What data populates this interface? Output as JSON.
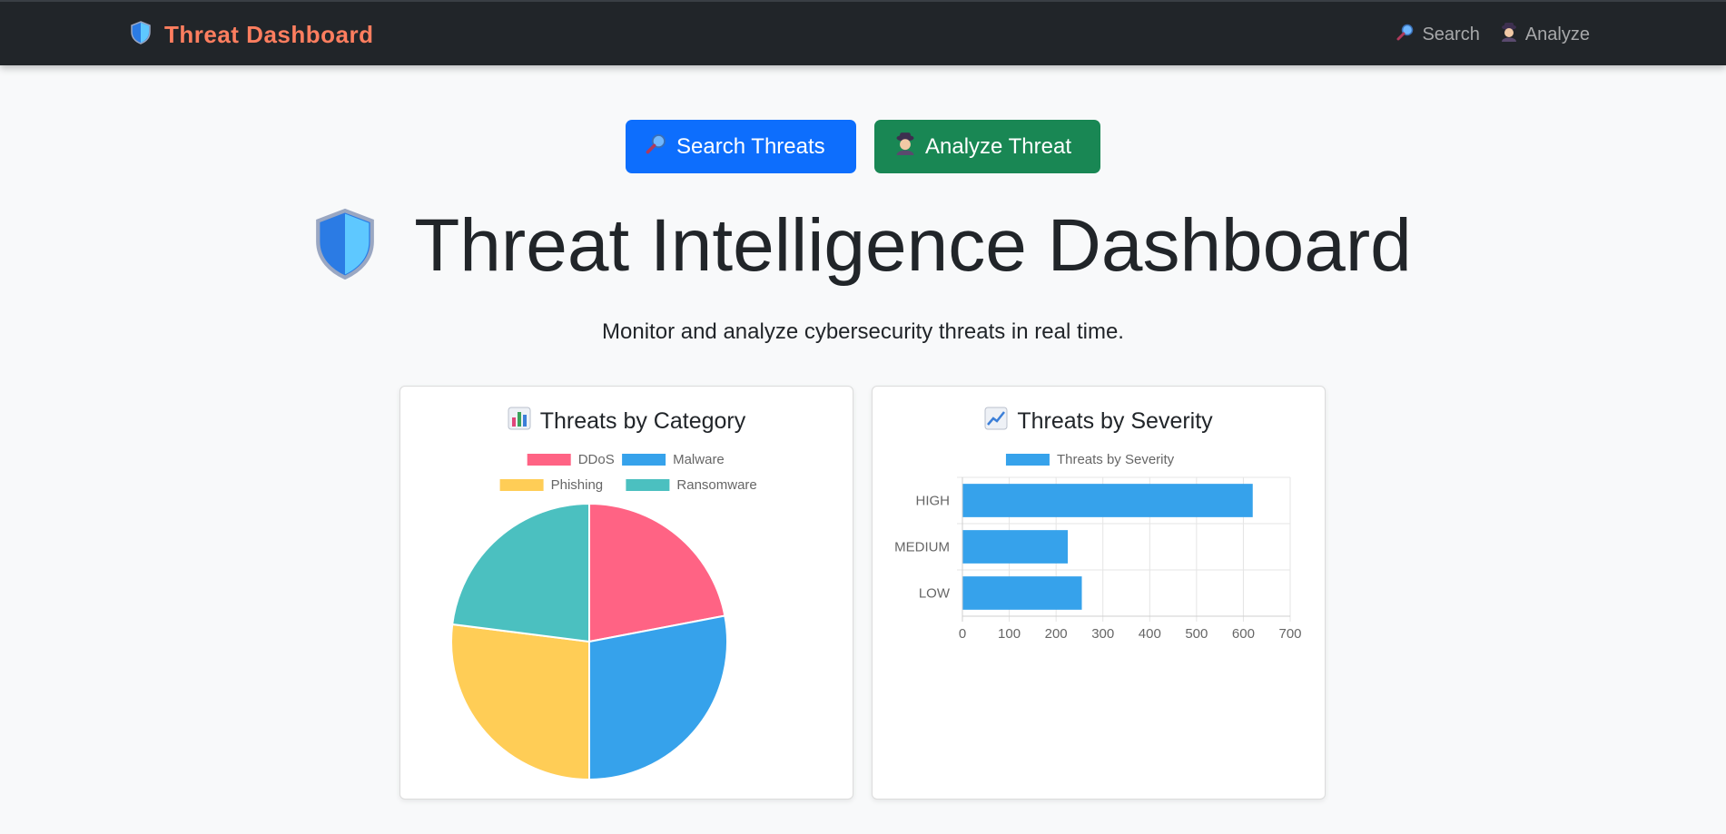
{
  "navbar": {
    "brand": "Threat Dashboard",
    "brand_icon": "shield-icon",
    "links": [
      {
        "label": "Search",
        "icon": "magnifier-icon"
      },
      {
        "label": "Analyze",
        "icon": "detective-icon"
      }
    ]
  },
  "actions": {
    "search_label": "Search Threats",
    "analyze_label": "Analyze Threat"
  },
  "hero": {
    "title": "Threat Intelligence Dashboard",
    "subtitle": "Monitor and analyze cybersecurity threats in real time."
  },
  "colors": {
    "brand": "#ff7e5f",
    "primary": "#0d6efd",
    "success": "#198754",
    "ddos": "#ff6384",
    "malware": "#36a2eb",
    "phishing": "#ffcd56",
    "ransomware": "#4bc0c0"
  },
  "chart_data": [
    {
      "type": "pie",
      "title": "Threats by Category",
      "title_icon": "bar-chart-icon",
      "categories": [
        "DDoS",
        "Malware",
        "Phishing",
        "Ransomware"
      ],
      "values": [
        22,
        28,
        27,
        23
      ],
      "colors": [
        "#ff6384",
        "#36a2eb",
        "#ffcd56",
        "#4bc0c0"
      ],
      "legend": "top"
    },
    {
      "type": "bar",
      "orientation": "horizontal",
      "title": "Threats by Severity",
      "title_icon": "line-chart-icon",
      "categories": [
        "HIGH",
        "MEDIUM",
        "LOW"
      ],
      "series": [
        {
          "name": "Threats by Severity",
          "values": [
            620,
            225,
            255
          ]
        }
      ],
      "xlim": [
        0,
        700
      ],
      "xticks": [
        "0",
        "100",
        "200",
        "300",
        "400",
        "500",
        "600",
        "700"
      ],
      "grid": true,
      "legend": "top",
      "color": "#36a2eb"
    }
  ]
}
